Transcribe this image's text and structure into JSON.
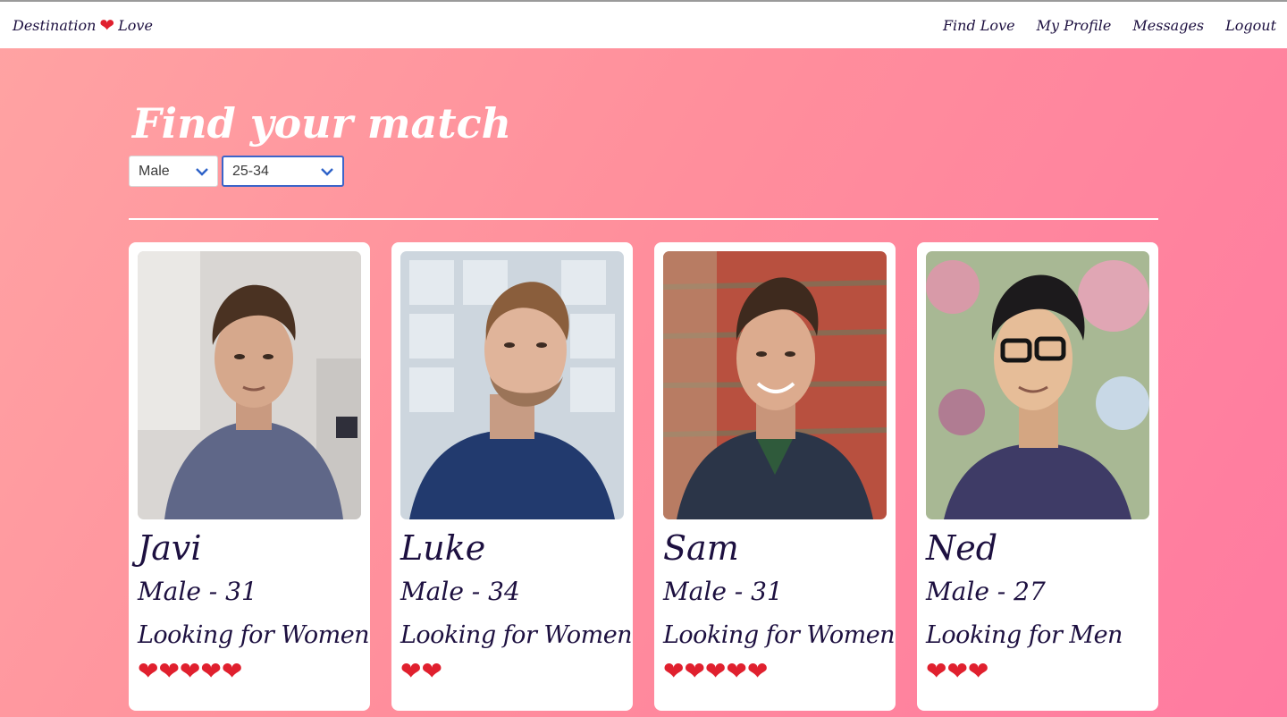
{
  "brand": {
    "left": "Destination",
    "heart_icon": "heart-icon",
    "right": "Love",
    "accent": "#e0202e"
  },
  "nav": [
    {
      "label": "Find Love"
    },
    {
      "label": "My Profile"
    },
    {
      "label": "Messages"
    },
    {
      "label": "Logout"
    }
  ],
  "page": {
    "title": "Find your match"
  },
  "filters": {
    "gender": "Male",
    "age": "25-34"
  },
  "colors": {
    "text": "#1d1040",
    "select_focus": "#3b64c9"
  },
  "matches": [
    {
      "name": "Javi",
      "gender_age": "Male - 31",
      "looking": "Looking for Women",
      "hearts": "❤❤❤❤❤",
      "rating": 5
    },
    {
      "name": "Luke",
      "gender_age": "Male - 34",
      "looking": "Looking for Women",
      "hearts": "❤❤",
      "rating": 2
    },
    {
      "name": "Sam",
      "gender_age": "Male - 31",
      "looking": "Looking for Women",
      "hearts": "❤❤❤❤❤",
      "rating": 5
    },
    {
      "name": "Ned",
      "gender_age": "Male - 27",
      "looking": "Looking for Men",
      "hearts": "❤❤❤",
      "rating": 3
    }
  ]
}
